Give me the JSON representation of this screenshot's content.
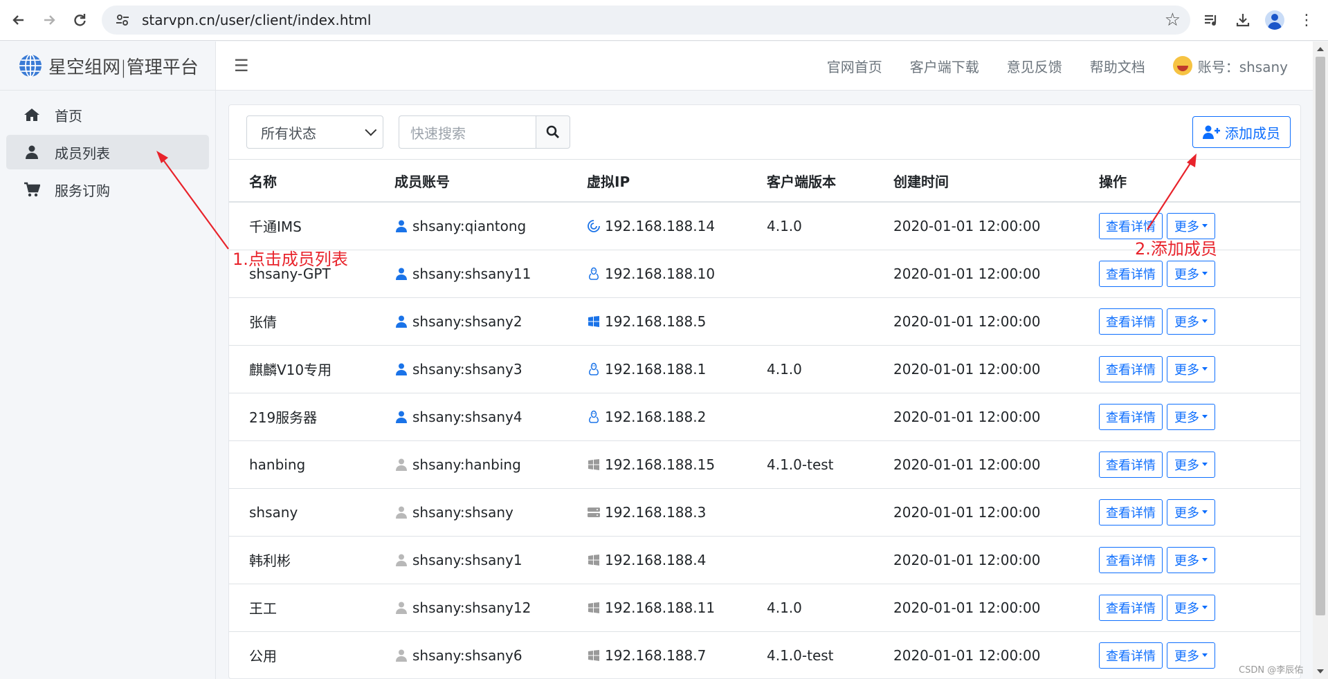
{
  "browser": {
    "url": "starvpn.cn/user/client/index.html"
  },
  "sidebar": {
    "brand": "星空组网|管理平台",
    "items": [
      {
        "label": "首页",
        "icon": "home-icon"
      },
      {
        "label": "成员列表",
        "icon": "user-icon"
      },
      {
        "label": "服务订购",
        "icon": "cart-icon"
      }
    ]
  },
  "topbar": {
    "links": [
      "官网首页",
      "客户端下载",
      "意见反馈",
      "帮助文档"
    ],
    "account": "账号：shsany"
  },
  "toolbar": {
    "status_selected": "所有状态",
    "search_placeholder": "快速搜索",
    "add_member": "添加成员"
  },
  "table": {
    "headers": [
      "名称",
      "成员账号",
      "虚拟IP",
      "客户端版本",
      "创建时间",
      "操作"
    ],
    "detail_label": "查看详情",
    "more_label": "更多",
    "rows": [
      {
        "name": "千通IMS",
        "account": "shsany:qiantong",
        "online": true,
        "os": "mac",
        "ip": "192.168.188.14",
        "version": "4.1.0",
        "created": "2020-01-01 12:00:00"
      },
      {
        "name": "shsany-GPT",
        "account": "shsany:shsany11",
        "online": true,
        "os": "linux",
        "ip": "192.168.188.10",
        "version": "",
        "created": "2020-01-01 12:00:00"
      },
      {
        "name": "张倩",
        "account": "shsany:shsany2",
        "online": true,
        "os": "windows",
        "ip": "192.168.188.5",
        "version": "",
        "created": "2020-01-01 12:00:00"
      },
      {
        "name": "麒麟V10专用",
        "account": "shsany:shsany3",
        "online": true,
        "os": "linux",
        "ip": "192.168.188.1",
        "version": "4.1.0",
        "created": "2020-01-01 12:00:00"
      },
      {
        "name": "219服务器",
        "account": "shsany:shsany4",
        "online": true,
        "os": "linux",
        "ip": "192.168.188.2",
        "version": "",
        "created": "2020-01-01 12:00:00"
      },
      {
        "name": "hanbing",
        "account": "shsany:hanbing",
        "online": false,
        "os": "windows",
        "ip": "192.168.188.15",
        "version": "4.1.0-test",
        "created": "2020-01-01 12:00:00"
      },
      {
        "name": "shsany",
        "account": "shsany:shsany",
        "online": false,
        "os": "server",
        "ip": "192.168.188.3",
        "version": "",
        "created": "2020-01-01 12:00:00"
      },
      {
        "name": "韩利彬",
        "account": "shsany:shsany1",
        "online": false,
        "os": "windows",
        "ip": "192.168.188.4",
        "version": "",
        "created": "2020-01-01 12:00:00"
      },
      {
        "name": "王工",
        "account": "shsany:shsany12",
        "online": false,
        "os": "windows",
        "ip": "192.168.188.11",
        "version": "4.1.0",
        "created": "2020-01-01 12:00:00"
      },
      {
        "name": "公用",
        "account": "shsany:shsany6",
        "online": false,
        "os": "windows",
        "ip": "192.168.188.7",
        "version": "4.1.0-test",
        "created": "2020-01-01 12:00:00"
      }
    ]
  },
  "annotations": {
    "step1": "1.点击成员列表",
    "step2": "2.添加成员"
  },
  "watermark": "CSDN @李辰佑",
  "colors": {
    "primary": "#0d6efd",
    "online": "#1a73e8",
    "offline": "#b8b8b8",
    "annotation": "#e8232b"
  }
}
